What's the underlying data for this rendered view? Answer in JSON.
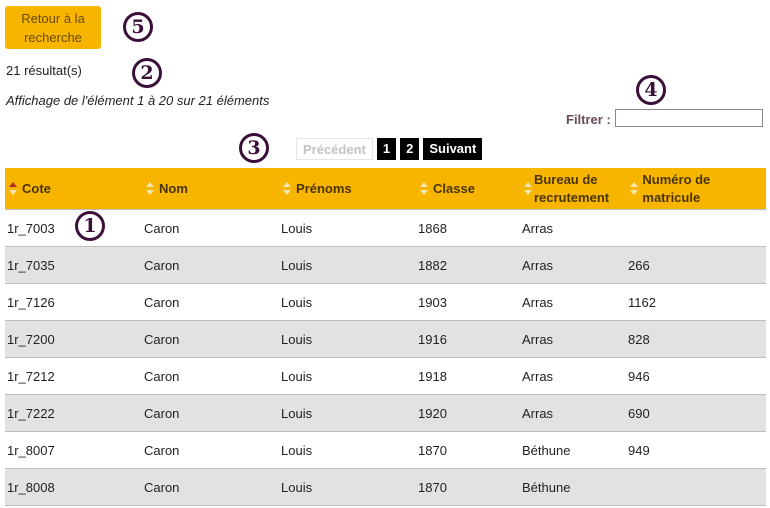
{
  "back_button": {
    "label": "Retour à la recherche"
  },
  "results": {
    "count_text": "21 résultat(s)",
    "info_text": "Affichage de l'élément 1 à 20 sur 21 éléments"
  },
  "filter": {
    "label": "Filtrer :",
    "value": ""
  },
  "pagination": {
    "previous": "Précédent",
    "pages": [
      "1",
      "2"
    ],
    "next": "Suivant"
  },
  "callouts": [
    "1",
    "2",
    "3",
    "4",
    "5"
  ],
  "table": {
    "columns": [
      "Cote",
      "Nom",
      "Prénoms",
      "Classe",
      "Bureau de recrutement",
      "Numéro de matricule"
    ],
    "rows": [
      [
        "1r_7003",
        "Caron",
        "Louis",
        "1868",
        "Arras",
        ""
      ],
      [
        "1r_7035",
        "Caron",
        "Louis",
        "1882",
        "Arras",
        "266"
      ],
      [
        "1r_7126",
        "Caron",
        "Louis",
        "1903",
        "Arras",
        "1162"
      ],
      [
        "1r_7200",
        "Caron",
        "Louis",
        "1916",
        "Arras",
        "828"
      ],
      [
        "1r_7212",
        "Caron",
        "Louis",
        "1918",
        "Arras",
        "946"
      ],
      [
        "1r_7222",
        "Caron",
        "Louis",
        "1920",
        "Arras",
        "690"
      ],
      [
        "1r_8007",
        "Caron",
        "Louis",
        "1870",
        "Béthune",
        "949"
      ],
      [
        "1r_8008",
        "Caron",
        "Louis",
        "1870",
        "Béthune",
        ""
      ]
    ]
  },
  "colors": {
    "accent": "#f7b500",
    "stripe": "#e2e2e2",
    "callout": "#3a0f3a"
  }
}
